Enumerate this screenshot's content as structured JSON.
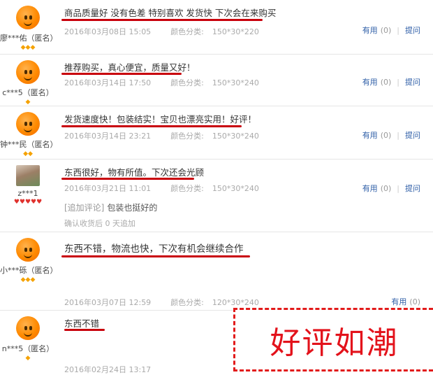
{
  "labels": {
    "color_label": "颜色分类:",
    "useful": "有用",
    "useful_count": "(0)",
    "ask": "提问",
    "separator": "|"
  },
  "reviews": [
    {
      "user": "廖***佑（匿名）",
      "text": "商品质量好 没有色差 特别喜欢 发货快 下次会在来购买",
      "date": "2016年03月08日 15:05",
      "color_value": "150*30*220"
    },
    {
      "user": "c***5（匿名）",
      "text": "推荐购买，真心便宜，质量又好！",
      "date": "2016年03月14日 17:50",
      "color_value": "150*30*240"
    },
    {
      "user": "钟***民（匿名）",
      "text": "发货速度快！包装结实！宝贝也漂亮实用！好评！",
      "date": "2016年03月14日 23:21",
      "color_value": "150*30*240"
    },
    {
      "user": "z***1",
      "text": "东西很好，物有所值。下次还会光顾",
      "date": "2016年03月21日 11:01",
      "color_value": "150*30*240",
      "append_tag": "[追加评论]",
      "append_text": "包装也挺好的",
      "append_meta": "确认收货后 0 天追加"
    },
    {
      "user": "小***砾（匿名）",
      "text": "东西不错，物流也快，下次有机会继续合作",
      "date": "2016年03月07日 12:59",
      "color_value": "120*30*240"
    },
    {
      "user": "n***5（匿名）",
      "text": "东西不错",
      "date": "2016年02月24日 13:17"
    }
  ],
  "stamp": {
    "text": "好评如潮",
    "color": "#e3121b"
  },
  "colors": {
    "underline": "#c8000b",
    "link": "#2e5ea7",
    "avatar": "#ff8a00"
  }
}
